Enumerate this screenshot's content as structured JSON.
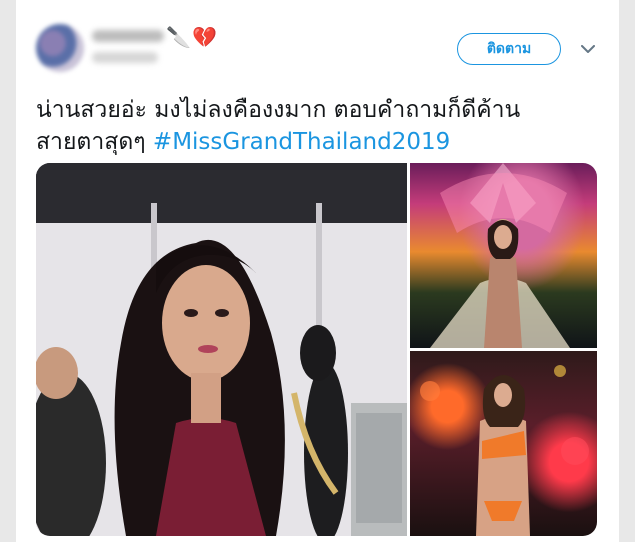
{
  "tweet": {
    "author_emojis": [
      "🔪",
      "💔"
    ],
    "follow_label": "ติดตาม",
    "text_line1": "น่านสวยอ่ะ มงไม่ลงคืองงมาก ตอบคำถามก็ดีค้าน",
    "text_line2_prefix": "สายตาสุดๆ ",
    "hashtag": "#MissGrandThailand2019"
  },
  "icons": {
    "caret": "chevron-down-icon",
    "knife": "knife-emoji",
    "heart": "broken-heart-emoji"
  },
  "colors": {
    "accent": "#1b95e0",
    "text": "#14171a",
    "background": "#ffffff"
  }
}
